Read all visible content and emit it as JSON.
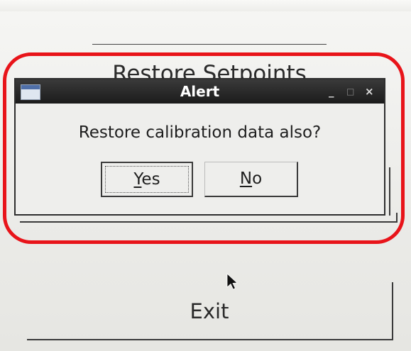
{
  "background_app": {
    "restore_button_label": "Restore Setpoints",
    "exit_button_label": "Exit"
  },
  "dialog": {
    "title": "Alert",
    "window_controls": {
      "minimize": "_",
      "maximize": "□",
      "close": "×"
    },
    "message": "Restore calibration data also?",
    "yes_button": {
      "mnemonic": "Y",
      "rest": "es"
    },
    "no_button": {
      "mnemonic": "N",
      "rest": "o"
    }
  },
  "annotation": {
    "highlight_color": "#e8141a"
  },
  "icons": {
    "app_icon": "window-icon",
    "pointer": "mouse-pointer-icon"
  }
}
